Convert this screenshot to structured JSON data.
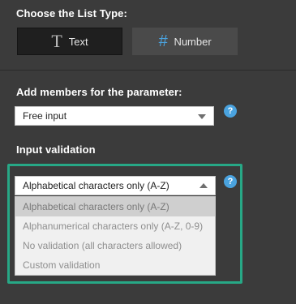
{
  "list_type": {
    "heading": "Choose the List Type:",
    "options": [
      {
        "label": "Text",
        "icon": "T",
        "selected": true
      },
      {
        "label": "Number",
        "icon": "#",
        "selected": false
      }
    ]
  },
  "members": {
    "heading": "Add members for the parameter:",
    "value": "Free input",
    "help": "?"
  },
  "validation": {
    "heading": "Input validation",
    "value": "Alphabetical characters only (A-Z)",
    "help": "?",
    "options": [
      {
        "label": "Alphabetical characters only (A-Z)",
        "selected": true
      },
      {
        "label": "Alphanumerical characters only (A-Z, 0-9)",
        "selected": false
      },
      {
        "label": "No validation (all characters allowed)",
        "selected": false
      },
      {
        "label": "Custom validation",
        "selected": false
      }
    ]
  },
  "colors": {
    "background": "#3b3b3b",
    "accent_blue": "#4aa3df",
    "highlight_green": "#27a886"
  }
}
